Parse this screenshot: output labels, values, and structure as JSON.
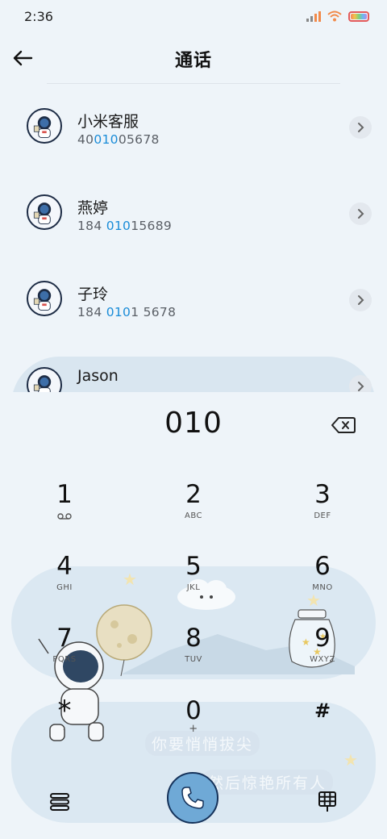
{
  "status_bar": {
    "time": "2:36"
  },
  "header": {
    "title": "通话"
  },
  "contacts": [
    {
      "name": "小米客服",
      "number_pre": "40",
      "number_match": "010",
      "number_post": "05678"
    },
    {
      "name": "燕婷",
      "number_pre": "184 ",
      "number_match": "010",
      "number_post": "15689"
    },
    {
      "name": "子玲",
      "number_pre": "184 ",
      "number_match": "010",
      "number_post": "1 5678"
    },
    {
      "name": "Jason",
      "number_pre": "",
      "number_match": "",
      "number_post": ""
    }
  ],
  "dialpad": {
    "input": "010",
    "keys": [
      {
        "digit": "1",
        "letters": ""
      },
      {
        "digit": "2",
        "letters": "ABC"
      },
      {
        "digit": "3",
        "letters": "DEF"
      },
      {
        "digit": "4",
        "letters": "GHI"
      },
      {
        "digit": "5",
        "letters": "JKL"
      },
      {
        "digit": "6",
        "letters": "MNO"
      },
      {
        "digit": "7",
        "letters": "PQRS"
      },
      {
        "digit": "8",
        "letters": "TUV"
      },
      {
        "digit": "9",
        "letters": "WXYZ"
      },
      {
        "digit": "*",
        "letters": ","
      },
      {
        "digit": "0",
        "letters": "+"
      },
      {
        "digit": "#",
        "letters": ""
      }
    ]
  },
  "wallpaper": {
    "line1": "你要悄悄拔尖",
    "line2": "然后惊艳所有人"
  },
  "colors": {
    "accent": "#1a8cd8",
    "call_button": "#6fa9d6",
    "background": "#eef4f9"
  },
  "icons": {
    "back": "arrow-left-icon",
    "chevron": "chevron-right-icon",
    "backspace": "backspace-icon",
    "voicemail": "voicemail-icon",
    "menu": "menu-icon",
    "call": "phone-icon",
    "keypad": "keypad-icon"
  }
}
